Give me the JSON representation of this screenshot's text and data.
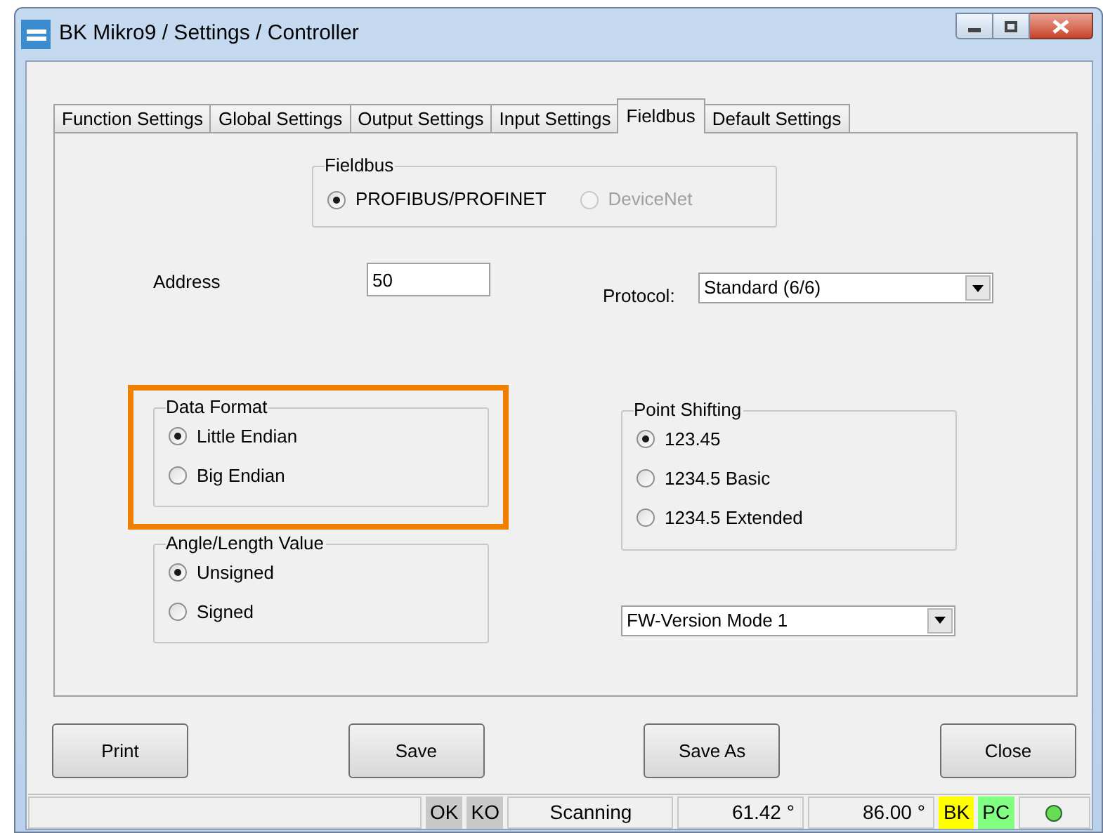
{
  "window": {
    "title": "BK Mikro9 / Settings / Controller"
  },
  "tabs": [
    {
      "label": "Function Settings",
      "selected": false
    },
    {
      "label": "Global Settings",
      "selected": false
    },
    {
      "label": "Output Settings",
      "selected": false
    },
    {
      "label": "Input Settings",
      "selected": false
    },
    {
      "label": "Fieldbus",
      "selected": true
    },
    {
      "label": "Default Settings",
      "selected": false
    }
  ],
  "fieldbus": {
    "title": "Fieldbus",
    "options": [
      {
        "label": "PROFIBUS/PROFINET",
        "selected": true,
        "disabled": false
      },
      {
        "label": "DeviceNet",
        "selected": false,
        "disabled": true
      }
    ]
  },
  "address": {
    "label": "Address",
    "value": "50"
  },
  "protocol": {
    "label": "Protocol:",
    "value": "Standard (6/6)"
  },
  "data_format": {
    "title": "Data Format",
    "highlighted": true,
    "options": [
      {
        "label": "Little Endian",
        "selected": true
      },
      {
        "label": "Big Endian",
        "selected": false
      }
    ]
  },
  "angle_length": {
    "title": "Angle/Length Value",
    "highlighted": false,
    "options": [
      {
        "label": "Unsigned",
        "selected": true
      },
      {
        "label": "Signed",
        "selected": false
      }
    ]
  },
  "point_shifting": {
    "title": "Point Shifting",
    "options": [
      {
        "label": "123.45",
        "selected": true
      },
      {
        "label": "1234.5 Basic",
        "selected": false
      },
      {
        "label": "1234.5 Extended",
        "selected": false
      }
    ]
  },
  "fw_version": {
    "value": "FW-Version Mode 1"
  },
  "buttons": [
    "Print",
    "Save",
    "Save As",
    "Close"
  ],
  "status_bar": [
    {
      "kind": "blank"
    },
    {
      "kind": "indicator",
      "text": "OK",
      "color": "#c8c8c8"
    },
    {
      "kind": "indicator",
      "text": "KO",
      "color": "#c8c8c8"
    },
    {
      "kind": "field",
      "text": "Scanning"
    },
    {
      "kind": "reading",
      "text": "61.42 °"
    },
    {
      "kind": "reading",
      "text": "86.00 °"
    },
    {
      "kind": "indicator",
      "text": "BK",
      "color": "#ffff00"
    },
    {
      "kind": "indicator",
      "text": "PC",
      "color": "#80ff80"
    },
    {
      "kind": "led",
      "color": "#66dd55"
    }
  ]
}
